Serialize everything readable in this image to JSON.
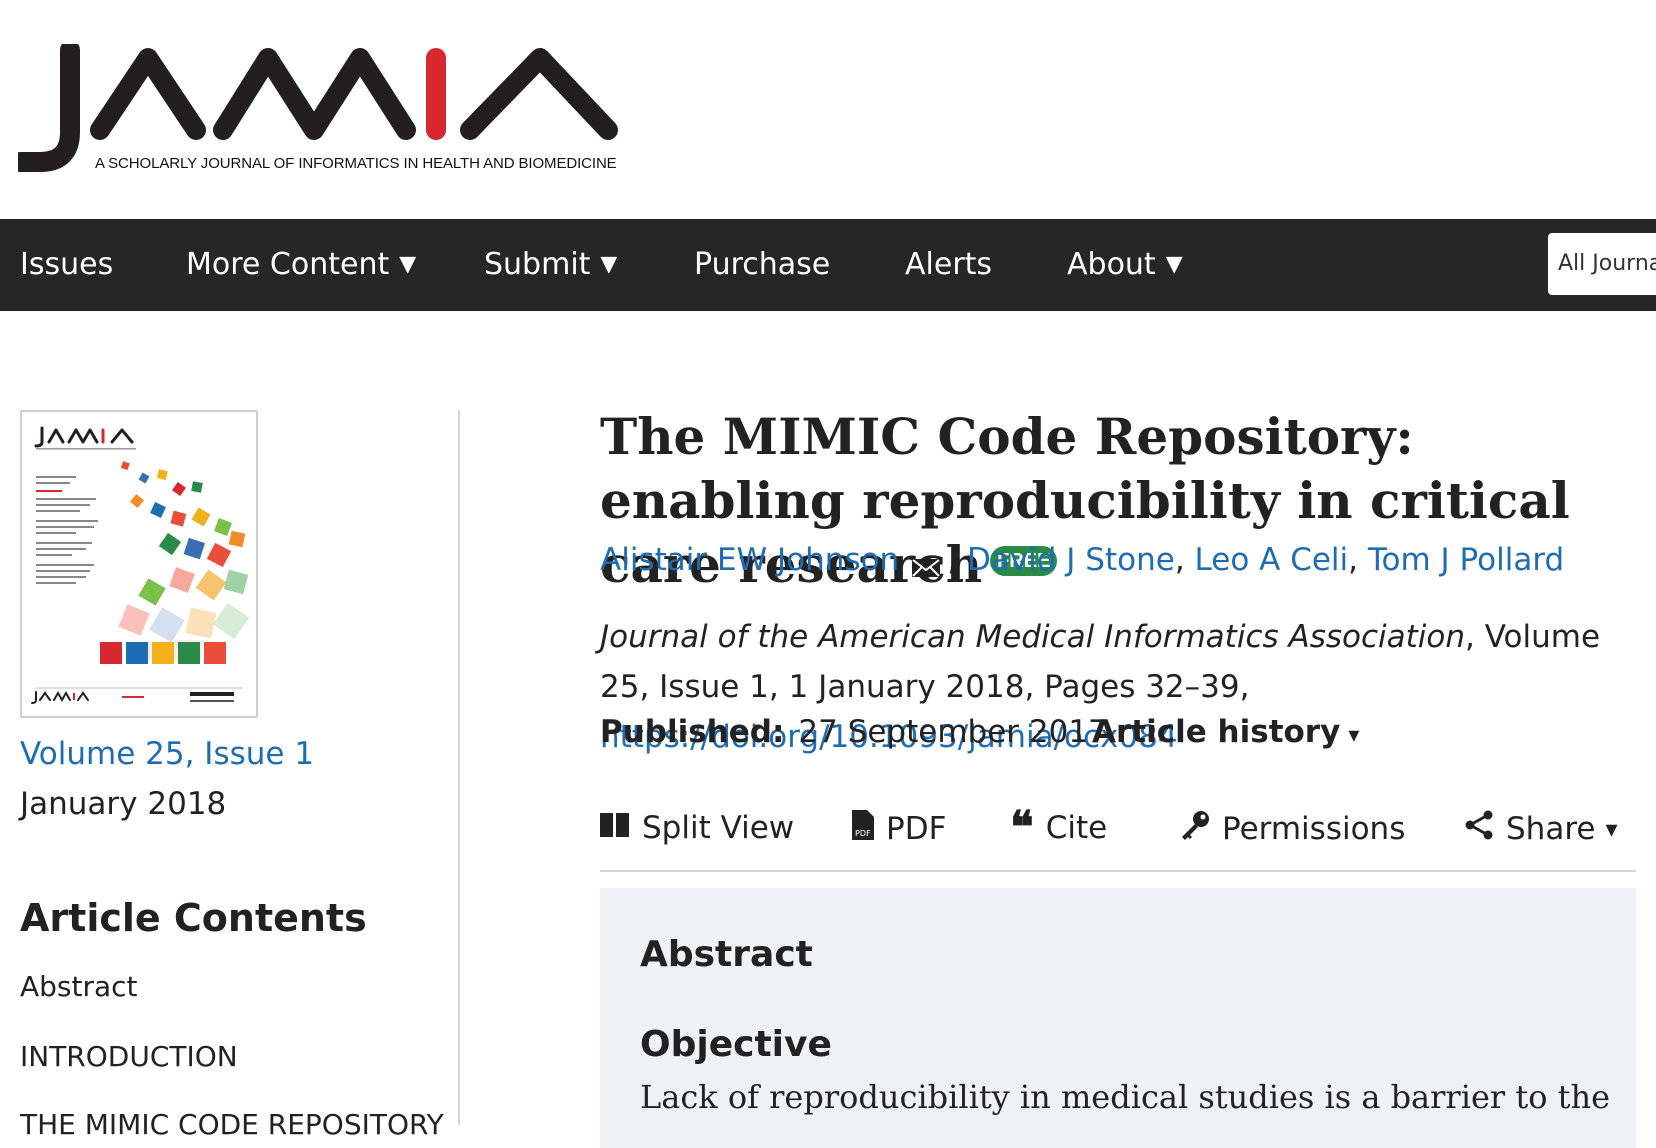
{
  "brand": {
    "logo_text": "JAMIA",
    "tagline": "A SCHOLARLY JOURNAL OF INFORMATICS IN HEALTH AND BIOMEDICINE"
  },
  "nav": {
    "items": [
      {
        "label": "Issues",
        "has_caret": false
      },
      {
        "label": "More Content",
        "has_caret": true
      },
      {
        "label": "Submit",
        "has_caret": true
      },
      {
        "label": "Purchase",
        "has_caret": false
      },
      {
        "label": "Alerts",
        "has_caret": false
      },
      {
        "label": "About",
        "has_caret": true
      }
    ],
    "caret": "▼",
    "search_scope": "All Journals"
  },
  "sidebar": {
    "cover_alt": "JAMIA",
    "issue_link": "Volume 25, Issue 1",
    "issue_date": "January 2018",
    "contents_heading": "Article Contents",
    "toc": [
      "Abstract",
      "INTRODUCTION",
      "THE MIMIC CODE REPOSITORY"
    ]
  },
  "article": {
    "title": "The MIMIC Code Repository: enabling reproducibility in critical care research",
    "free_badge": "FREE",
    "authors": [
      "Alistair EW Johnson",
      "David J Stone",
      "Leo A Celi",
      "Tom J Pollard"
    ],
    "journal": "Journal of the American Medical Informatics Association",
    "citation_rest": ", Volume 25, Issue 1, 1 January 2018, Pages 32–39, ",
    "doi": "https://doi.org/10.1093/jamia/ocx084",
    "published_label": "Published:",
    "published_date": "27 September 2017",
    "history_label": "Article history",
    "history_caret": "▾"
  },
  "tools": {
    "split_view": "Split View",
    "pdf": "PDF",
    "cite": "Cite",
    "permissions": "Permissions",
    "share": "Share",
    "share_caret": "▾"
  },
  "abstract": {
    "heading": "Abstract",
    "objective_heading": "Objective",
    "objective_text": "Lack of reproducibility in medical studies is a barrier to the"
  },
  "colors": {
    "nav_bg": "#262626",
    "link": "#1e6db4",
    "accent_red": "#d7282f",
    "free_green": "#2a8a47",
    "abstract_bg": "#eef2f6"
  }
}
